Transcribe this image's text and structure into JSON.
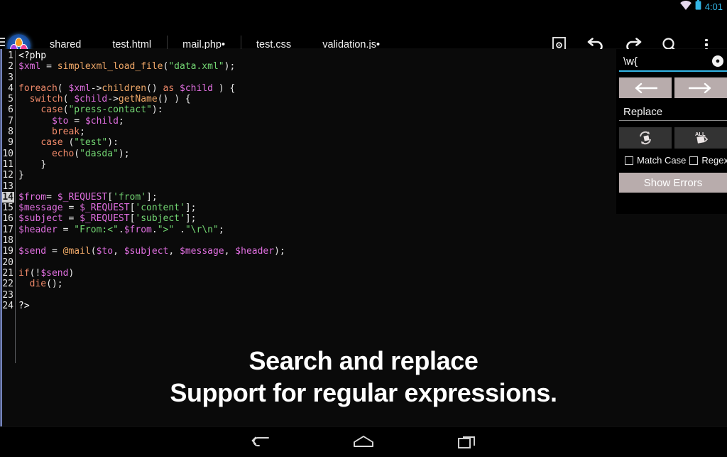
{
  "statusbar": {
    "time": "4:01",
    "wifi_icon": "wifi-icon",
    "battery_icon": "battery-icon",
    "accent_color": "#33b5e5"
  },
  "actionbar": {
    "drawer_icon": "hamburger-menu-icon",
    "logo_icon": "app-logo-icon",
    "project_label": "shared",
    "tabs": [
      {
        "label": "test.html",
        "active": false,
        "modified": false
      },
      {
        "label": "mail.php•",
        "active": true,
        "modified": true
      },
      {
        "label": "test.css",
        "active": false,
        "modified": false
      },
      {
        "label": "validation.js•",
        "active": false,
        "modified": true
      }
    ],
    "toolbar": [
      {
        "name": "save-icon",
        "label": "Save"
      },
      {
        "name": "undo-icon",
        "label": "Undo"
      },
      {
        "name": "redo-icon",
        "label": "Redo"
      },
      {
        "name": "search-icon",
        "label": "Search"
      },
      {
        "name": "overflow-menu-icon",
        "label": "More options"
      }
    ]
  },
  "editor": {
    "language": "php",
    "current_line": 14,
    "line_count": 24,
    "line_numbers": [
      "1",
      "2",
      "3",
      "4",
      "5",
      "6",
      "7",
      "8",
      "9",
      "10",
      "11",
      "12",
      "13",
      "14",
      "15",
      "16",
      "17",
      "18",
      "19",
      "20",
      "21",
      "22",
      "23",
      "24"
    ],
    "lines": [
      "<?php",
      "$xml = simplexml_load_file(\"data.xml\");",
      "",
      "foreach( $xml->children() as $child ) {",
      "  switch( $child->getName() ) {",
      "    case(\"press-contact\"):",
      "      $to = $child;",
      "      break;",
      "    case (\"test\"):",
      "      echo(\"dasda\");",
      "    }",
      "}",
      "",
      "$from= $_REQUEST['from'];",
      "$message = $_REQUEST['content'];",
      "$subject = $_REQUEST['subject'];",
      "$header = \"From:<\".$from.\">\" .\"\\r\\n\";",
      "",
      "$send = @mail($to, $subject, $message, $header);",
      "",
      "if(!$send)",
      "  die();",
      "",
      "?>"
    ],
    "colors": {
      "background": "#0a0a0a",
      "variable": "#e06fe0",
      "function": "#f0a868",
      "keyword": "#f08a6a",
      "string": "#73d673",
      "plain": "#e8e8e8"
    }
  },
  "search_panel": {
    "search_value": "\\w{",
    "clear_icon": "clear-circle-icon",
    "find_prev_icon": "arrow-left-icon",
    "find_next_icon": "arrow-right-icon",
    "replace_placeholder": "Replace",
    "replace_value": "",
    "replace_one_icon": "replace-one-icon",
    "replace_all_icon": "replace-all-icon",
    "match_case_label": "Match Case",
    "match_case_checked": false,
    "regex_label": "Regex",
    "regex_checked": false,
    "show_errors_label": "Show Errors",
    "underline_color": "#33b5e5"
  },
  "promo": {
    "line1": "Search and replace",
    "line2": "Support for regular expressions."
  },
  "navbar": {
    "back_icon": "back-arrow-icon",
    "home_icon": "home-icon",
    "recents_icon": "recent-apps-icon"
  }
}
